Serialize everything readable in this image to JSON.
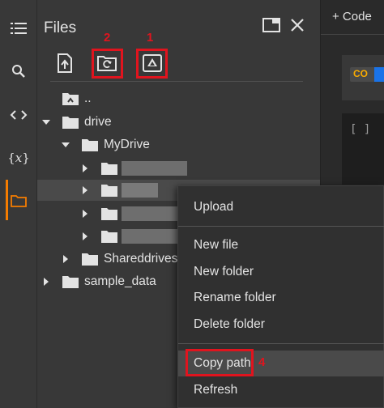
{
  "rail": {
    "icons": [
      "menu-icon",
      "search-icon",
      "code-icon",
      "variables-icon",
      "folder-icon"
    ],
    "variables_label": "{𝑥}",
    "accent": "#f57c00"
  },
  "files_panel": {
    "title": "Files",
    "toolbar": {
      "upload_icon": "upload-file-icon",
      "refresh_icon": "refresh-folder-icon",
      "drive_icon": "mount-drive-icon"
    },
    "annotations": {
      "drive_number": "1",
      "refresh_number": "2",
      "copy_path_number": "4"
    },
    "tree": {
      "up_label": "..",
      "drive_label": "drive",
      "mydrive_label": "MyDrive",
      "shared_label": "Shareddrives",
      "sample_label": "sample_data"
    }
  },
  "editor": {
    "code_button": "+ Code",
    "co_badge": "CO",
    "cell_text": "[ ]"
  },
  "context_menu": {
    "upload": "Upload",
    "new_file": "New file",
    "new_folder": "New folder",
    "rename_folder": "Rename folder",
    "delete_folder": "Delete folder",
    "copy_path": "Copy path",
    "refresh": "Refresh"
  },
  "colors": {
    "annotation_red": "#e0141e",
    "background": "#383838"
  }
}
